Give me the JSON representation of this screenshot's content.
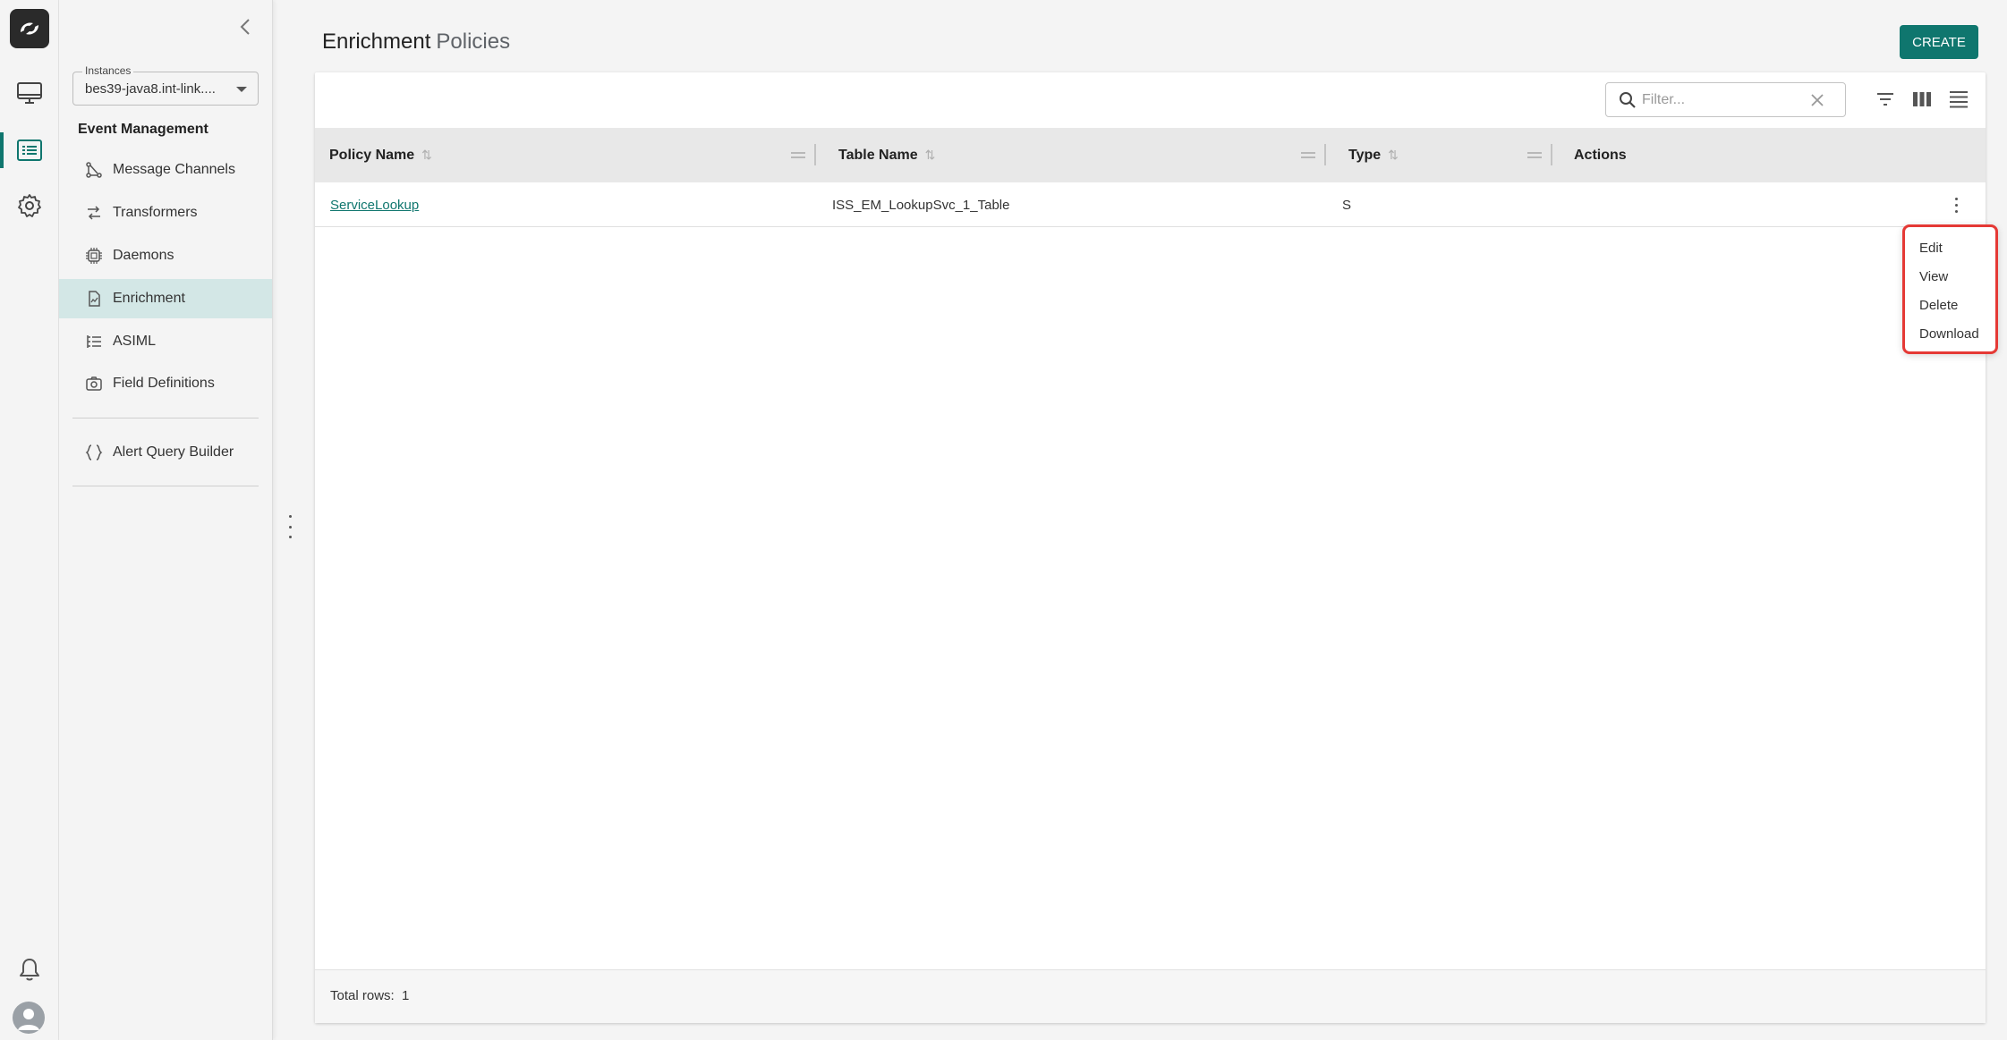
{
  "nav_rail": {
    "items": [
      {
        "icon": "desktop-icon"
      },
      {
        "icon": "list-icon",
        "active": true
      },
      {
        "icon": "gear-icon"
      }
    ],
    "bottom": [
      "bell-icon",
      "avatar"
    ]
  },
  "sidebar": {
    "instances": {
      "label": "Instances",
      "value": "bes39-java8.int-link...."
    },
    "section_title": "Event Management",
    "items": [
      {
        "label": "Message Channels",
        "icon": "flow-icon"
      },
      {
        "label": "Transformers",
        "icon": "transform-icon"
      },
      {
        "label": "Daemons",
        "icon": "chip-icon"
      },
      {
        "label": "Enrichment",
        "icon": "document-icon",
        "active": true
      },
      {
        "label": "ASIML",
        "icon": "tree-list-icon"
      },
      {
        "label": "Field Definitions",
        "icon": "camera-icon"
      },
      {
        "label": "Alert Query Builder",
        "icon": "braces-icon"
      }
    ]
  },
  "header": {
    "title_main": "Enrichment",
    "title_sub": "Policies",
    "create_label": "CREATE"
  },
  "table": {
    "filter_placeholder": "Filter...",
    "columns": [
      "Policy Name",
      "Table Name",
      "Type",
      "Actions"
    ],
    "rows": [
      {
        "policy_name": "ServiceLookup",
        "table_name": "ISS_EM_LookupSvc_1_Table",
        "type": "S"
      }
    ],
    "footer": {
      "label": "Total rows:",
      "count": "1"
    }
  },
  "row_actions_menu": {
    "items": [
      "Edit",
      "View",
      "Delete",
      "Download"
    ]
  },
  "colors": {
    "accent": "#0f766e",
    "active_nav_bg": "#d3e7e6",
    "menu_highlight_border": "#e53935"
  }
}
